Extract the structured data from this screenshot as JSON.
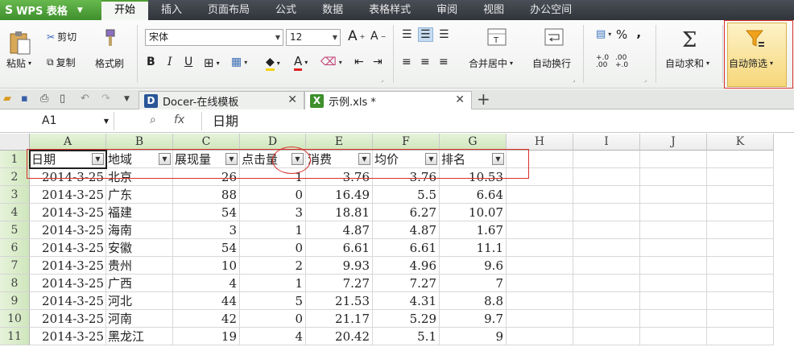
{
  "app": {
    "logo_text": "WPS 表格",
    "logo_mark": "S"
  },
  "menu": {
    "tabs": [
      "开始",
      "插入",
      "页面布局",
      "公式",
      "数据",
      "表格样式",
      "审阅",
      "视图",
      "办公空间"
    ]
  },
  "ribbon": {
    "paste": "粘贴",
    "cut": "剪切",
    "copy": "复制",
    "format_painter": "格式刷",
    "font_name": "宋体",
    "font_size": "12",
    "merge_center": "合并居中",
    "wrap_text": "自动换行",
    "autosum": "自动求和",
    "autofilter": "自动筛选",
    "percent": "%",
    "comma": "‚",
    "bold": "B",
    "italic": "I",
    "underline": "U",
    "font_grow": "A",
    "font_shrink": "A",
    "font_color_letter": "A",
    "sigma": "Σ",
    "colors": {
      "accent_green": "#4e9d34",
      "highlight_red": "#d9302a",
      "filter_orange": "#f0a21a"
    }
  },
  "tabs_bar": {
    "tabs": [
      {
        "label": "Docer-在线模板",
        "icon": "D"
      },
      {
        "label": "示例.xls *",
        "icon": "X"
      }
    ],
    "add": "+"
  },
  "formula_bar": {
    "cell_ref": "A1",
    "fx": "fx",
    "value": "日期"
  },
  "sheet": {
    "columns": [
      "A",
      "B",
      "C",
      "D",
      "E",
      "F",
      "G",
      "H",
      "I",
      "J",
      "K"
    ],
    "rows": [
      "1",
      "2",
      "3",
      "4",
      "5",
      "6",
      "7",
      "8",
      "9",
      "10",
      "11"
    ],
    "headers": [
      "日期",
      "地域",
      "展现量",
      "点击量",
      "消费",
      "均价",
      "排名"
    ],
    "data": [
      [
        "2014-3-25",
        "北京",
        "26",
        "1",
        "3.76",
        "3.76",
        "10.53"
      ],
      [
        "2014-3-25",
        "广东",
        "88",
        "0",
        "16.49",
        "5.5",
        "6.64"
      ],
      [
        "2014-3-25",
        "福建",
        "54",
        "3",
        "18.81",
        "6.27",
        "10.07"
      ],
      [
        "2014-3-25",
        "海南",
        "3",
        "1",
        "4.87",
        "4.87",
        "1.67"
      ],
      [
        "2014-3-25",
        "安徽",
        "54",
        "0",
        "6.61",
        "6.61",
        "11.1"
      ],
      [
        "2014-3-25",
        "贵州",
        "10",
        "2",
        "9.93",
        "4.96",
        "9.6"
      ],
      [
        "2014-3-25",
        "广西",
        "4",
        "1",
        "7.27",
        "7.27",
        "7"
      ],
      [
        "2014-3-25",
        "河北",
        "44",
        "5",
        "21.53",
        "4.31",
        "8.8"
      ],
      [
        "2014-3-25",
        "河南",
        "42",
        "0",
        "21.17",
        "5.29",
        "9.7"
      ],
      [
        "2014-3-25",
        "黑龙江",
        "19",
        "4",
        "20.42",
        "5.1",
        "9"
      ]
    ]
  }
}
